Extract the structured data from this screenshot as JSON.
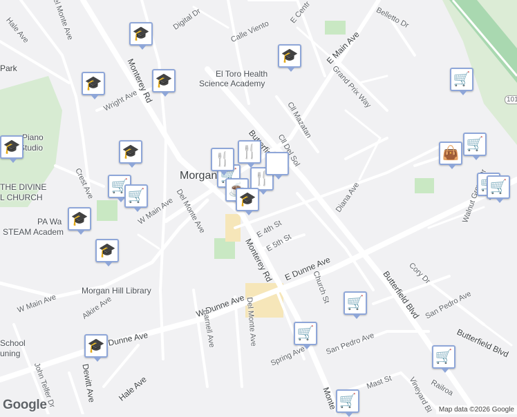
{
  "map": {
    "labels": {
      "hale_ave_top": "Hale Ave",
      "del_monte_top": "Del Monte Ave",
      "digital_dr": "Digital Dr",
      "calle_viento": "Calle Viento",
      "e_central": "E Centr",
      "belletto": "Belletto Dr",
      "e_main": "E Main Ave",
      "el_toro": "El Toro Health",
      "el_toro2": "Science Academy",
      "grand_prix": "Grand Prix Way",
      "park": "Park",
      "monterey_rd_top": "Monterey Rd",
      "wright": "Wright Ave",
      "cll_mazatan": "Cll Mazatan",
      "cll_del_sol": "Cll Del Sol",
      "piano": "Piano",
      "studio": "Studio",
      "morgan": "Morgan",
      "butterfield_top": "Butterfield Blvd",
      "crest": "Crest Ave",
      "diana": "Diana Ave",
      "walnut_grove": "Walnut Grove Dr",
      "divine": "THE DIVINE",
      "church": "L CHURCH",
      "w_main": "W Main Ave",
      "del_monte_mid": "Del Monte Ave",
      "pa_wa": "PA Wa",
      "steam": "STEAM Academ",
      "e_4th": "E 4th St",
      "e_5th": "E 5th St",
      "monterey_rd_mid": "Monterey Rd",
      "e_dunne": "E Dunne Ave",
      "cory": "Cory Dr",
      "church_st": "Church St",
      "butterfield_mid": "Butterfield Blvd",
      "library": "Morgan Hill Library",
      "w_main_low": "W Main Ave",
      "san_pedro_right": "San Pedro Ave",
      "alkire": "Alkire Ave",
      "w_dunne": "W Dunne Ave",
      "barnell": "Barnell Ave",
      "del_monte_low": "Del Monte Ave",
      "dunne_ave_left": "Dunne Ave",
      "school": "School",
      "uning": "uning",
      "butterfield_right": "Butterfield Blvd",
      "san_pedro_low": "San Pedro Ave",
      "spring": "Spring Ave",
      "john_telfer": "John Telfer Dr",
      "dewitt": "Dewitt Ave",
      "hale_low": "Hale Ave",
      "mast": "Mast St",
      "vineyard": "Vineyard Bl",
      "railroad": "Railroa",
      "monterey_low": "Monte",
      "hwy": "101"
    },
    "google_logo": "Google",
    "attribution": "Map data ©2026 Google"
  },
  "markers": [
    {
      "icon": "school-icon",
      "glyph": "🎓"
    },
    {
      "icon": "school-icon",
      "glyph": "🎓"
    },
    {
      "icon": "school-icon",
      "glyph": "🎓"
    },
    {
      "icon": "school-icon",
      "glyph": "🎓"
    },
    {
      "icon": "school-icon",
      "glyph": "🎓"
    },
    {
      "icon": "school-icon",
      "glyph": "🎓"
    },
    {
      "icon": "school-icon",
      "glyph": "🎓"
    },
    {
      "icon": "school-icon",
      "glyph": "🎓"
    },
    {
      "icon": "school-icon",
      "glyph": "🎓"
    },
    {
      "icon": "grocery-cart-icon",
      "glyph": "🛒"
    },
    {
      "icon": "grocery-cart-icon",
      "glyph": "🛒"
    },
    {
      "icon": "grocery-cart-icon",
      "glyph": "🛒"
    },
    {
      "icon": "grocery-cart-icon",
      "glyph": "🛒"
    },
    {
      "icon": "grocery-cart-icon",
      "glyph": "🛒"
    },
    {
      "icon": "grocery-cart-icon",
      "glyph": "🛒"
    },
    {
      "icon": "grocery-cart-icon",
      "glyph": "🛒"
    },
    {
      "icon": "grocery-cart-icon",
      "glyph": "🛒"
    },
    {
      "icon": "grocery-cart-icon",
      "glyph": "🛒"
    },
    {
      "icon": "grocery-cart-icon",
      "glyph": "🛒"
    },
    {
      "icon": "grocery-cart-icon",
      "glyph": "🛒"
    },
    {
      "icon": "coffee-cup-icon",
      "glyph": "☕"
    },
    {
      "icon": "shopping-bag-icon",
      "glyph": "👜"
    },
    {
      "icon": "restaurant-icon",
      "glyph": "🍴"
    },
    {
      "icon": "restaurant-icon",
      "glyph": "🍴"
    },
    {
      "icon": "restaurant-icon",
      "glyph": "🍴"
    },
    {
      "icon": "school-icon",
      "glyph": "🎓"
    }
  ],
  "colors": {
    "land": "#f1f1f3",
    "road": "#ffffff",
    "park": "#c9e8c3",
    "highway": "#a9d8b0",
    "sand": "#f6e6b9",
    "marker_border": "#8ea6d8",
    "marker_icon": "#1c2a4d"
  }
}
